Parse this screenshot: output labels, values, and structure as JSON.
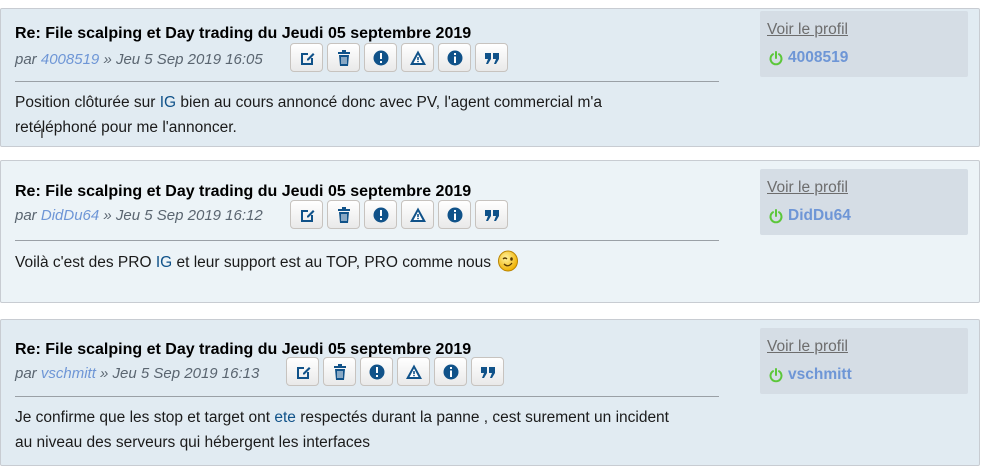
{
  "posts": [
    {
      "title": "Re: File scalping et Day trading du Jeudi 05 septembre 2019",
      "author_prefix": "par",
      "author": "4008519",
      "date": "» Jeu 5 Sep 2019 16:05",
      "content": {
        "part1": "Position clôturée sur ",
        "link": "IG",
        "part2": " bien au cours annoncé donc avec PV, l'agent commercial m'a",
        "line2": "retéléphoné pour me l'annoncer."
      },
      "profile": {
        "view_label": "Voir le profil",
        "username": "4008519"
      }
    },
    {
      "title": "Re: File scalping et Day trading du Jeudi 05 septembre 2019",
      "author_prefix": "par",
      "author": "DidDu64",
      "date": "» Jeu 5 Sep 2019 16:12",
      "content": {
        "part1": "Voilà c'est des PRO ",
        "link": "IG",
        "part2": " et leur support est au TOP, PRO comme nous"
      },
      "profile": {
        "view_label": "Voir le profil",
        "username": "DidDu64"
      }
    },
    {
      "title": "Re: File scalping et Day trading du Jeudi 05 septembre 2019",
      "author_prefix": "par",
      "author": "vschmitt",
      "date": "» Jeu 5 Sep 2019 16:13",
      "content": {
        "part1": "Je confirme que les stop et target ont ",
        "link": "ete",
        "part2": " respectés durant la panne , cest surement un incident",
        "line2": "au niveau des serveurs qui hébergent les interfaces"
      },
      "profile": {
        "view_label": "Voir le profil",
        "username": "vschmitt"
      }
    }
  ],
  "post_buttons": [
    "edit-icon",
    "delete-icon",
    "report-icon",
    "warn-icon",
    "info-icon",
    "quote-icon"
  ],
  "colors": {
    "post_bg_1": "#e1ebf2",
    "post_bg_2": "#ecf3f7",
    "username": "#6e96d6",
    "link": "#105289",
    "online": "#5cc73a",
    "icon": "#105289"
  }
}
